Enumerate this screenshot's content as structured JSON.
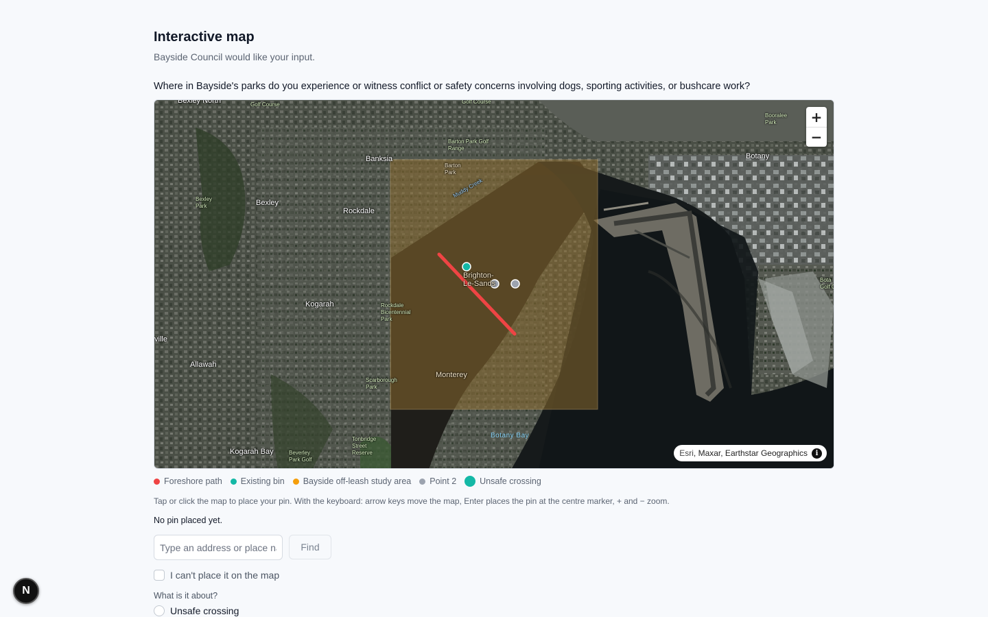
{
  "header": {
    "title": "Interactive map",
    "subtitle": "Bayside Council would like your input."
  },
  "question": "Where in Bayside's parks do you experience or witness conflict or safety concerns involving dogs, sporting activities, or bushcare work?",
  "map": {
    "zoom_in": "+",
    "zoom_out": "−",
    "attribution": {
      "esri": "Esri",
      "rest": ", Maxar, Earthstar Geographics",
      "info": "i"
    },
    "labels": {
      "bexley_north": "Bexley North",
      "golf_course_1": "Golf Course",
      "golf_course_2": "Golf Course",
      "barton_park_golf": "Barton Park Golf Range",
      "banksia": "Banksia",
      "barton_park": "Barton Park",
      "muddy_creek": "Muddy Creek",
      "booralee_park": "Booralee Park",
      "botany": "Botany",
      "bexley_park": "Bexley Park",
      "bexley": "Bexley",
      "rockdale": "Rockdale",
      "brighton": "Brighton-Le-Sands",
      "kogarah": "Kogarah",
      "rockdale_bicentennial": "Rockdale Bicentennial Park",
      "ville": "ville",
      "allawah": "Allawah",
      "scarborough_park": "Scarborough Park",
      "monterey": "Monterey",
      "tonbridge": "Tonbridge Street Reserve",
      "botany_bay": "Botany Bay",
      "kogarah_bay": "Kogarah Bay",
      "beverley_park": "Beverley Park Golf",
      "bota_golf": "Bota Golf C"
    }
  },
  "legend": [
    {
      "label": "Foreshore path",
      "color": "#ef4444"
    },
    {
      "label": "Existing bin",
      "color": "#14b8a6"
    },
    {
      "label": "Bayside off-leash study area",
      "color": "#f59e0b"
    },
    {
      "label": "Point 2",
      "color": "#9ca3af"
    },
    {
      "label": "Unsafe crossing",
      "color": "#14b8a6"
    }
  ],
  "hint": "Tap or click the map to place your pin. With the keyboard: arrow keys move the map, Enter places the pin at the centre marker, + and − zoom.",
  "status": "No pin placed yet.",
  "search": {
    "placeholder": "Type an address or place name",
    "button": "Find"
  },
  "cant_place": "I can't place it on the map",
  "about_label": "What is it about?",
  "option_unsafe": "Unsafe crossing",
  "badge": "N"
}
